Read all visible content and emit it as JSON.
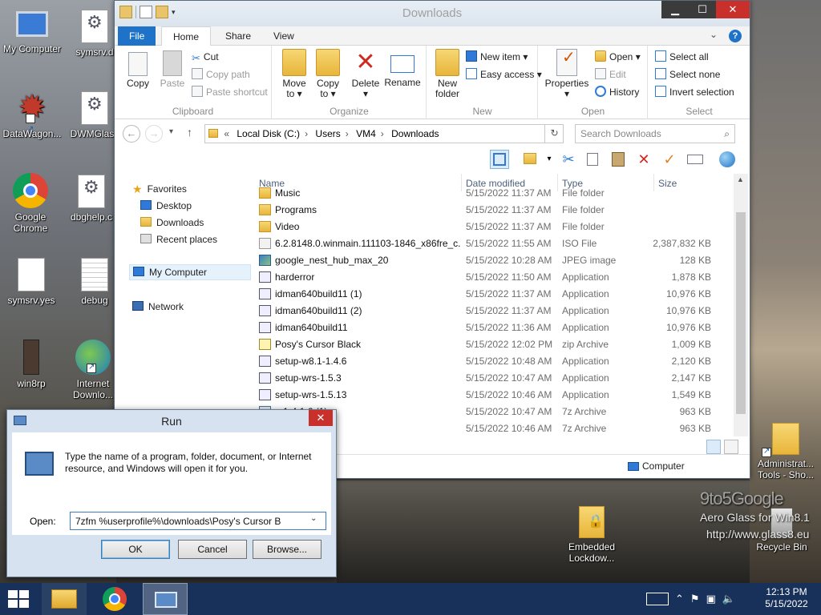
{
  "desktop": {
    "icons": [
      {
        "label": "My Computer"
      },
      {
        "label": "symsrv.d"
      },
      {
        "label": "DataWagon..."
      },
      {
        "label": "DWMGlass"
      },
      {
        "label": "Google Chrome"
      },
      {
        "label": "dbghelp.c"
      },
      {
        "label": "symsrv.yes"
      },
      {
        "label": "debug"
      },
      {
        "label": "win8rp"
      },
      {
        "label": "Internet Downlo..."
      },
      {
        "label": "Administrat... Tools - Sho..."
      },
      {
        "label": "Embedded Lockdow..."
      },
      {
        "label": "Recycle Bin"
      }
    ],
    "watermark": {
      "brand": "9to5Google",
      "line1": "Aero Glass for Win8.1",
      "line2": "http://www.glass8.eu"
    }
  },
  "explorer": {
    "title": "Downloads",
    "tabs": [
      "File",
      "Home",
      "Share",
      "View"
    ],
    "ribbon": {
      "clipboard": {
        "label": "Clipboard",
        "copy": "Copy",
        "paste": "Paste",
        "cut": "Cut",
        "copy_path": "Copy path",
        "paste_shortcut": "Paste shortcut"
      },
      "organize": {
        "label": "Organize",
        "move_to": "Move to ▾",
        "copy_to": "Copy to ▾",
        "delete": "Delete ▾",
        "rename": "Rename"
      },
      "new": {
        "label": "New",
        "new_folder": "New folder",
        "new_item": "New item ▾",
        "easy_access": "Easy access ▾"
      },
      "open": {
        "label": "Open",
        "properties": "Properties ▾",
        "open": "Open ▾",
        "edit": "Edit",
        "history": "History"
      },
      "select": {
        "label": "Select",
        "select_all": "Select all",
        "select_none": "Select none",
        "invert": "Invert selection"
      }
    },
    "address": {
      "prefix": "«",
      "crumbs": [
        "Local Disk (C:)",
        "Users",
        "VM4",
        "Downloads"
      ],
      "search_placeholder": "Search Downloads"
    },
    "nav": {
      "favorites": "Favorites",
      "desktop": "Desktop",
      "downloads": "Downloads",
      "recent": "Recent places",
      "my_computer": "My Computer",
      "network": "Network"
    },
    "columns": {
      "name": "Name",
      "date": "Date modified",
      "type": "Type",
      "size": "Size"
    },
    "files": [
      {
        "name": "Music",
        "date": "5/15/2022 11:37 AM",
        "type": "File folder",
        "size": "",
        "icon": "folder"
      },
      {
        "name": "Programs",
        "date": "5/15/2022 11:37 AM",
        "type": "File folder",
        "size": "",
        "icon": "folder"
      },
      {
        "name": "Video",
        "date": "5/15/2022 11:37 AM",
        "type": "File folder",
        "size": "",
        "icon": "folder"
      },
      {
        "name": "6.2.8148.0.winmain.111103-1846_x86fre_c...",
        "date": "5/15/2022 11:55 AM",
        "type": "ISO File",
        "size": "2,387,832 KB",
        "icon": "iso"
      },
      {
        "name": "google_nest_hub_max_20",
        "date": "5/15/2022 10:28 AM",
        "type": "JPEG image",
        "size": "128 KB",
        "icon": "img"
      },
      {
        "name": "harderror",
        "date": "5/15/2022 11:50 AM",
        "type": "Application",
        "size": "1,878 KB",
        "icon": "app"
      },
      {
        "name": "idman640build11 (1)",
        "date": "5/15/2022 11:37 AM",
        "type": "Application",
        "size": "10,976 KB",
        "icon": "app"
      },
      {
        "name": "idman640build11 (2)",
        "date": "5/15/2022 11:37 AM",
        "type": "Application",
        "size": "10,976 KB",
        "icon": "app"
      },
      {
        "name": "idman640build11",
        "date": "5/15/2022 11:36 AM",
        "type": "Application",
        "size": "10,976 KB",
        "icon": "app"
      },
      {
        "name": "Posy's Cursor Black",
        "date": "5/15/2022 12:02 PM",
        "type": "zip Archive",
        "size": "1,009 KB",
        "icon": "zip"
      },
      {
        "name": "setup-w8.1-1.4.6",
        "date": "5/15/2022 10:48 AM",
        "type": "Application",
        "size": "2,120 KB",
        "icon": "app"
      },
      {
        "name": "setup-wrs-1.5.3",
        "date": "5/15/2022 10:47 AM",
        "type": "Application",
        "size": "2,147 KB",
        "icon": "app"
      },
      {
        "name": "setup-wrs-1.5.13",
        "date": "5/15/2022 10:46 AM",
        "type": "Application",
        "size": "1,549 KB",
        "icon": "app"
      },
      {
        "name": "...1-4.1.6 (1)",
        "date": "5/15/2022 10:47 AM",
        "type": "7z Archive",
        "size": "963 KB",
        "icon": "7z"
      },
      {
        "name": "...5",
        "date": "5/15/2022 10:46 AM",
        "type": "7z Archive",
        "size": "963 KB",
        "icon": "7z"
      }
    ],
    "status_location": "Computer"
  },
  "run_dialog": {
    "title": "Run",
    "description": "Type the name of a program, folder, document, or Internet resource, and Windows will open it for you.",
    "open_label": "Open:",
    "input_value": "7zfm %userprofile%\\downloads\\Posy's Cursor B",
    "ok": "OK",
    "cancel": "Cancel",
    "browse": "Browse..."
  },
  "taskbar": {
    "time": "12:13 PM",
    "date": "5/15/2022"
  }
}
